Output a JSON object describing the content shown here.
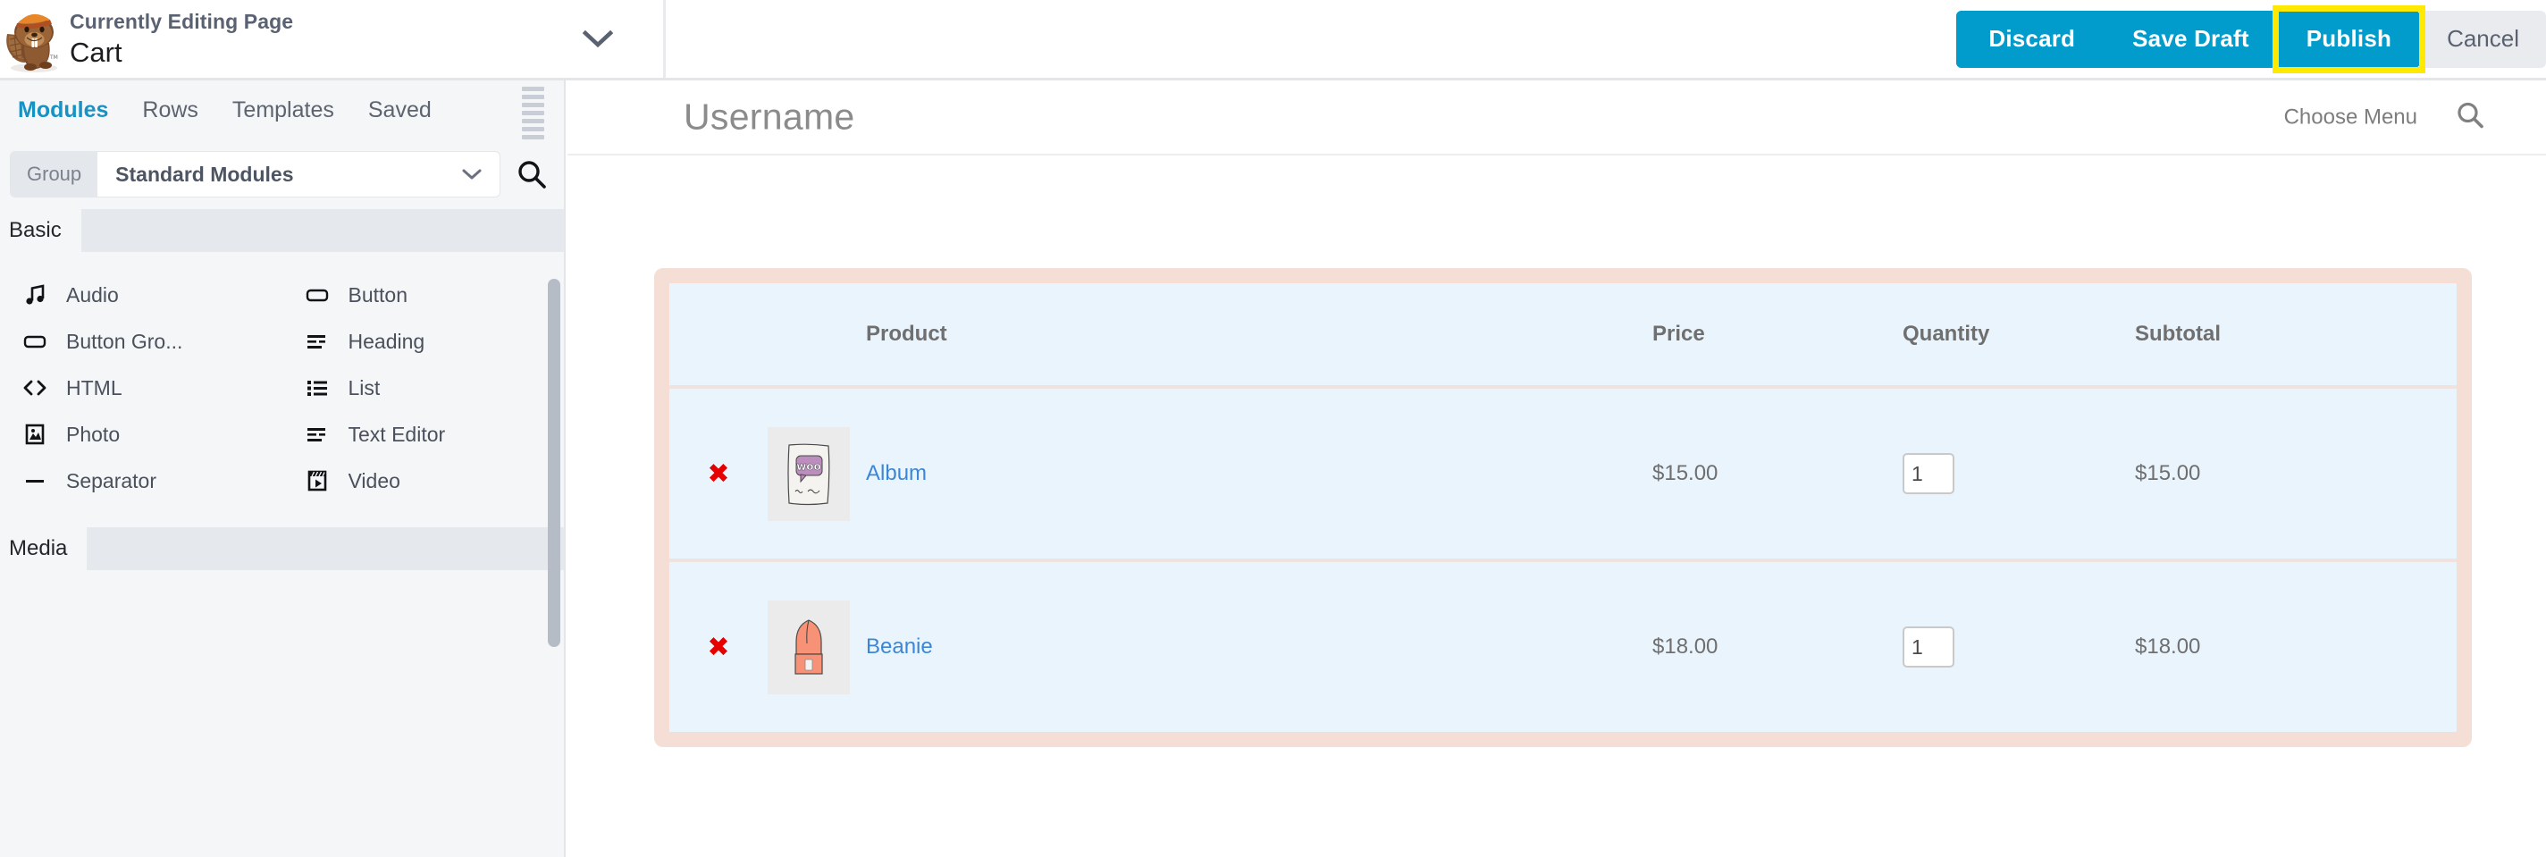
{
  "topbar": {
    "logo_icon": "beaver-builder-logo",
    "kicker": "Currently Editing Page",
    "page_title": "Cart",
    "chevron_icon": "chevron-down-icon",
    "actions": {
      "discard": "Discard",
      "save_draft": "Save Draft",
      "publish": "Publish",
      "cancel": "Cancel"
    },
    "colors": {
      "primary_button": "#019ccc",
      "highlight_outline": "#ffe900",
      "cancel_button": "#e9ebee"
    }
  },
  "panel": {
    "tabs": [
      {
        "label": "Modules",
        "active": true
      },
      {
        "label": "Rows",
        "active": false
      },
      {
        "label": "Templates",
        "active": false
      },
      {
        "label": "Saved",
        "active": false
      }
    ],
    "drag_handle_icon": "drag-handle-icon",
    "group": {
      "label": "Group",
      "value": "Standard Modules",
      "caret_icon": "chevron-down-icon",
      "search_icon": "search-icon"
    },
    "sections": [
      {
        "name": "Basic",
        "modules": [
          {
            "label": "Audio",
            "icon": "audio-note-icon"
          },
          {
            "label": "Button",
            "icon": "button-icon"
          },
          {
            "label": "Button Gro...",
            "icon": "button-group-icon"
          },
          {
            "label": "Heading",
            "icon": "heading-icon"
          },
          {
            "label": "HTML",
            "icon": "code-icon"
          },
          {
            "label": "List",
            "icon": "list-icon"
          },
          {
            "label": "Photo",
            "icon": "photo-icon"
          },
          {
            "label": "Text Editor",
            "icon": "text-editor-icon"
          },
          {
            "label": "Separator",
            "icon": "separator-icon"
          },
          {
            "label": "Video",
            "icon": "video-icon"
          }
        ]
      },
      {
        "name": "Media",
        "modules": []
      }
    ]
  },
  "site": {
    "title": "Username",
    "choose_menu": "Choose Menu",
    "search_icon": "search-icon"
  },
  "cart": {
    "columns": [
      "",
      "",
      "Product",
      "Price",
      "Quantity",
      "Subtotal"
    ],
    "rows": [
      {
        "remove_label": "✖",
        "thumb_icon": "album-product-thumb",
        "product": "Album",
        "price": "$15.00",
        "quantity": "1",
        "subtotal": "$15.00"
      },
      {
        "remove_label": "✖",
        "thumb_icon": "beanie-product-thumb",
        "product": "Beanie",
        "price": "$18.00",
        "quantity": "1",
        "subtotal": "$18.00"
      }
    ],
    "colors": {
      "cell_bg": "#eaf4fd",
      "outer_border": "#f4ded6",
      "link": "#3b87d6",
      "remove": "#e60000"
    }
  }
}
